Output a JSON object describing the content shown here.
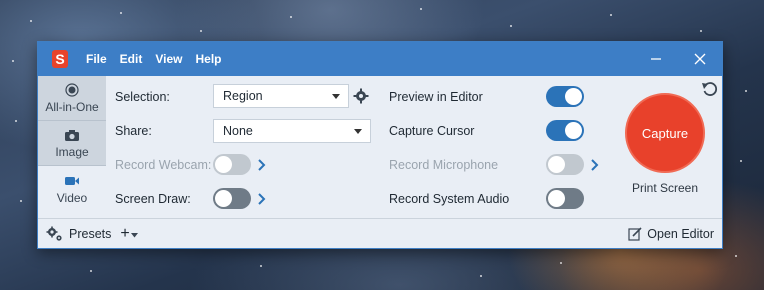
{
  "app": {
    "logo_letter": "S",
    "menu": [
      "File",
      "Edit",
      "View",
      "Help"
    ]
  },
  "modes": [
    {
      "label": "All-in-One",
      "icon": "radio-dot-icon",
      "active": false
    },
    {
      "label": "Image",
      "icon": "camera-icon",
      "active": false
    },
    {
      "label": "Video",
      "icon": "video-camera-icon",
      "active": true
    }
  ],
  "settings": {
    "selection_label": "Selection:",
    "selection_value": "Region",
    "share_label": "Share:",
    "share_value": "None",
    "webcam_label": "Record Webcam:",
    "webcam_on": false,
    "screen_draw_label": "Screen Draw:",
    "screen_draw_on": false,
    "preview_label": "Preview in Editor",
    "preview_on": true,
    "cursor_label": "Capture Cursor",
    "cursor_on": true,
    "microphone_label": "Record Microphone",
    "microphone_on": false,
    "system_audio_label": "Record System Audio",
    "system_audio_on": false
  },
  "capture": {
    "button_label": "Capture",
    "hotkey": "Print Screen"
  },
  "footer": {
    "presets_label": "Presets",
    "add_label": "+",
    "open_editor_label": "Open Editor"
  },
  "colors": {
    "titlebar": "#3d7ec6",
    "capture": "#e8412b",
    "toggle_on": "#2b73b8"
  }
}
